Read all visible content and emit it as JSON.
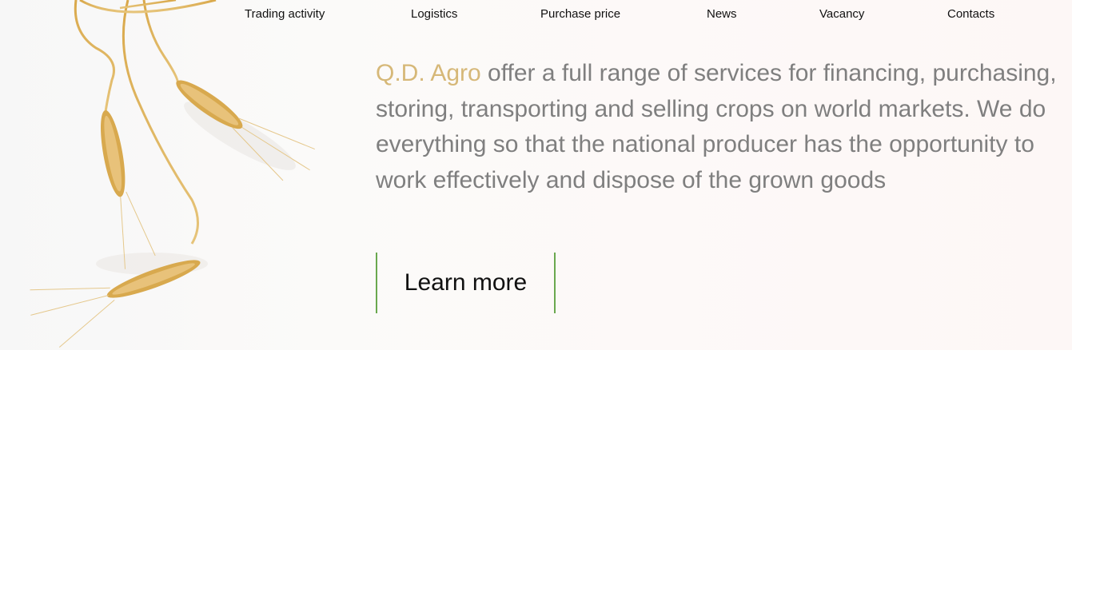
{
  "nav": {
    "items": [
      {
        "label": "Trading activity"
      },
      {
        "label": "Logistics"
      },
      {
        "label": "Purchase price"
      },
      {
        "label": "News"
      },
      {
        "label": "Vacancy"
      },
      {
        "label": "Contacts"
      }
    ]
  },
  "hero": {
    "brand": "Q.D. Agro",
    "text": " offer a full range of services for financing, purchasing, storing, transporting and selling crops on world markets. We do everything so that the national producer has the opportunity to work effectively and dispose of the grown goods",
    "cta_label": "Learn more",
    "image": "wheat-ears-illustration"
  },
  "colors": {
    "brand": "#d6b878",
    "body_text": "#7f7f7f",
    "cta_border": "#6aa84f",
    "hero_bg": "#fdf8f7"
  }
}
